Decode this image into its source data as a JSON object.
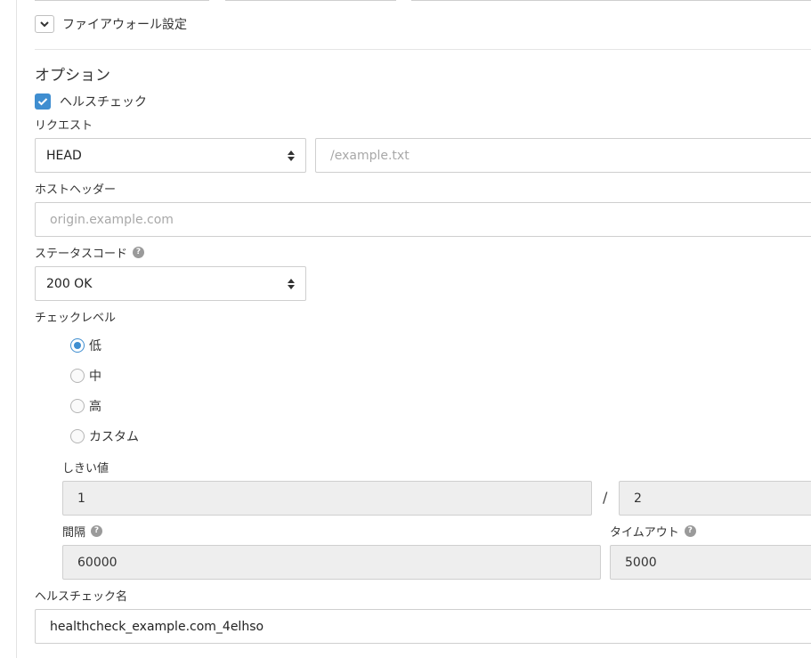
{
  "firewall": {
    "toggle_label": "ファイアウォール設定"
  },
  "options": {
    "title": "オプション",
    "healthcheck_label": "ヘルスチェック",
    "healthcheck_checked": true
  },
  "request": {
    "label": "リクエスト",
    "method_value": "HEAD",
    "path_placeholder": "/example.txt"
  },
  "host_header": {
    "label": "ホストヘッダー",
    "placeholder": "origin.example.com"
  },
  "status_code": {
    "label": "ステータスコード",
    "value": "200 OK"
  },
  "check_level": {
    "label": "チェックレベル",
    "options": [
      {
        "label": "低",
        "checked": true
      },
      {
        "label": "中",
        "checked": false
      },
      {
        "label": "高",
        "checked": false
      },
      {
        "label": "カスタム",
        "checked": false
      }
    ]
  },
  "threshold": {
    "label": "しきい値",
    "value_1": "1",
    "separator": "/",
    "value_2": "2"
  },
  "interval": {
    "label": "間隔",
    "value": "60000"
  },
  "timeout": {
    "label": "タイムアウト",
    "value": "5000"
  },
  "healthcheck_name": {
    "label": "ヘルスチェック名",
    "value": "healthcheck_example.com_4elhso"
  },
  "icons": {
    "help": "?"
  },
  "colors": {
    "accent": "#3f8ed0",
    "disabled_bg": "#eeeeee",
    "border": "#cfcfcf"
  }
}
